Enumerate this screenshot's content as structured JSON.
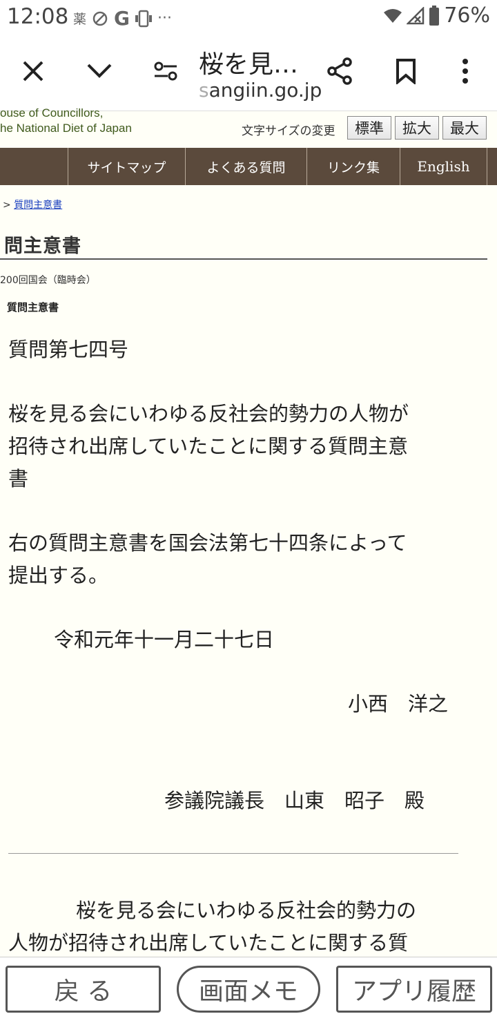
{
  "status": {
    "time": "12:08",
    "notif1": "薬",
    "notif2": "G",
    "more": "···",
    "battery": "76%"
  },
  "browser": {
    "title": "桜を見…",
    "domain_prefix": "s",
    "domain_rest": "angiin.go.jp"
  },
  "site": {
    "logo_line1": "ouse of Councillors,",
    "logo_line2": "he National Diet of Japan",
    "fontsize_label": "文字サイズの変更",
    "fs_standard": "標準",
    "fs_large": "拡大",
    "fs_max": "最大"
  },
  "nav": {
    "sitemap": "サイトマップ",
    "faq": "よくある質問",
    "links": "リンク集",
    "english": "English"
  },
  "content": {
    "breadcrumb_sep": ">",
    "breadcrumb_link": "質問主意書",
    "page_title": "問主意書",
    "session": "200回国会（臨時会）",
    "subhead": "質問主意書",
    "question_no": "質問第七四号",
    "q_title_1": "桜を見る会にいわゆる反社会的勢力の人物が",
    "q_title_2": "招待され出席していたことに関する質問主意",
    "q_title_3": "書",
    "submit_1": "右の質問主意書を国会法第七十四条によって",
    "submit_2": "提出する。",
    "date": "令和元年十一月二十七日",
    "author": "小西　洋之",
    "addressee": "参議院議長　山東　昭子　殿",
    "body_1": "桜を見る会にいわゆる反社会的勢力の",
    "body_2": "人物が招待され出席していたことに関する質"
  },
  "bottom": {
    "back": "戻 る",
    "memo": "画面メモ",
    "history": "アプリ履歴"
  }
}
